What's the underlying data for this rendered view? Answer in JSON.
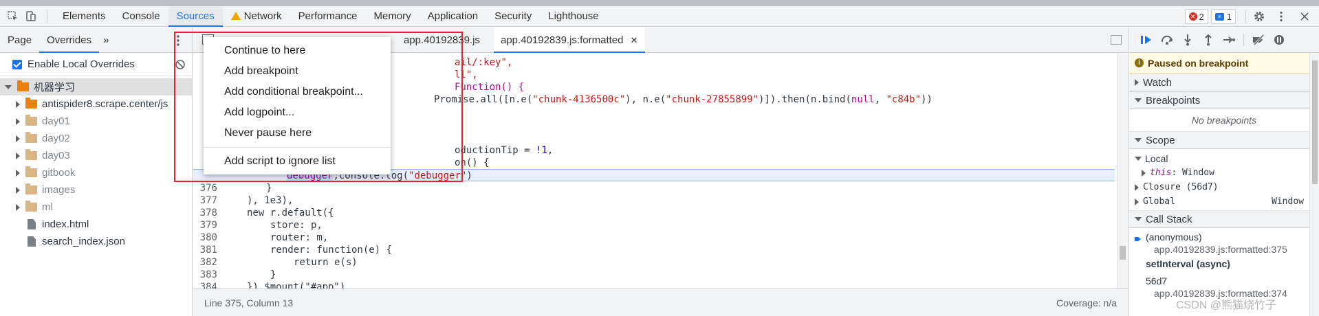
{
  "toolbar": {
    "tabs": [
      "Elements",
      "Console",
      "Sources",
      "Network",
      "Performance",
      "Memory",
      "Application",
      "Security",
      "Lighthouse"
    ],
    "errors_count": "2",
    "messages_count": "1"
  },
  "navigator": {
    "tabs": [
      "Page",
      "Overrides"
    ],
    "more": "»",
    "enable_overrides": "Enable Local Overrides",
    "root_folder": "机器学习",
    "items": [
      {
        "label": "antispider8.scrape.center/js",
        "kind": "folder-orange"
      },
      {
        "label": "day01",
        "kind": "folder-tan"
      },
      {
        "label": "day02",
        "kind": "folder-tan"
      },
      {
        "label": "day03",
        "kind": "folder-tan"
      },
      {
        "label": "gitbook",
        "kind": "folder-tan"
      },
      {
        "label": "images",
        "kind": "folder-tan"
      },
      {
        "label": "ml",
        "kind": "folder-tan"
      },
      {
        "label": "index.html",
        "kind": "file"
      },
      {
        "label": "search_index.json",
        "kind": "file"
      }
    ]
  },
  "editor": {
    "tabs": [
      "app.40192839.js",
      "app.40192839.js:formatted"
    ],
    "close_glyph": "✕",
    "code_fragments": {
      "f1": "ail/:key\",",
      "f2": "ll\",",
      "f3": "Function() {",
      "f4_a": "Promise.all([n.e(",
      "f4_s1": "\"chunk-4136500c\"",
      "f4_b": "), n.e(",
      "f4_s2": "\"chunk-27855899\"",
      "f4_c": ")]).then(n.bind(",
      "f4_null": "null",
      "f4_d": ", ",
      "f4_s3": "\"c84b\"",
      "f4_e": "))",
      "f5_a": "oductionTip = ",
      "f5_b": "!1",
      "f5_c": ",",
      "f6": "on() {",
      "dbg_word": "debugger",
      "f7_a": ";console.log(",
      "f7_s": "\"debugger\"",
      "f7_b": ")"
    },
    "lines": [
      {
        "n": "376",
        "text": "}"
      },
      {
        "n": "377",
        "text": "), 1e3),"
      },
      {
        "n": "378",
        "text": "new r.default({"
      },
      {
        "n": "379",
        "text": "store: p,"
      },
      {
        "n": "380",
        "text": "router: m,"
      },
      {
        "n": "381",
        "text": "render: function(e) {"
      },
      {
        "n": "382",
        "text": "return e(s)"
      },
      {
        "n": "383",
        "text": "}"
      },
      {
        "n": "384",
        "text": "}).$mount(\"#app\")"
      }
    ],
    "line_376": "376",
    "status_position": "Line 375, Column 13",
    "coverage": "Coverage: n/a"
  },
  "context_menu": {
    "items": [
      "Continue to here",
      "Add breakpoint",
      "Add conditional breakpoint...",
      "Add logpoint...",
      "Never pause here"
    ],
    "ignore_item": "Add script to ignore list"
  },
  "sidebar": {
    "paused_label": "Paused on breakpoint",
    "watch": "Watch",
    "breakpoints": "Breakpoints",
    "no_breakpoints": "No breakpoints",
    "scope": "Scope",
    "local": "Local",
    "this_key": "this",
    "this_val": ": Window",
    "closure": "Closure (56d7)",
    "global": "Global",
    "global_val": "Window",
    "call_stack": "Call Stack",
    "frames": [
      {
        "name": "(anonymous)",
        "loc": "app.40192839.js:formatted:375"
      },
      {
        "name": "setInterval (async)",
        "loc": ""
      },
      {
        "name": "56d7",
        "loc": "app.40192839.js:formatted:374"
      }
    ]
  },
  "watermark": "CSDN @熊猫烧竹子"
}
